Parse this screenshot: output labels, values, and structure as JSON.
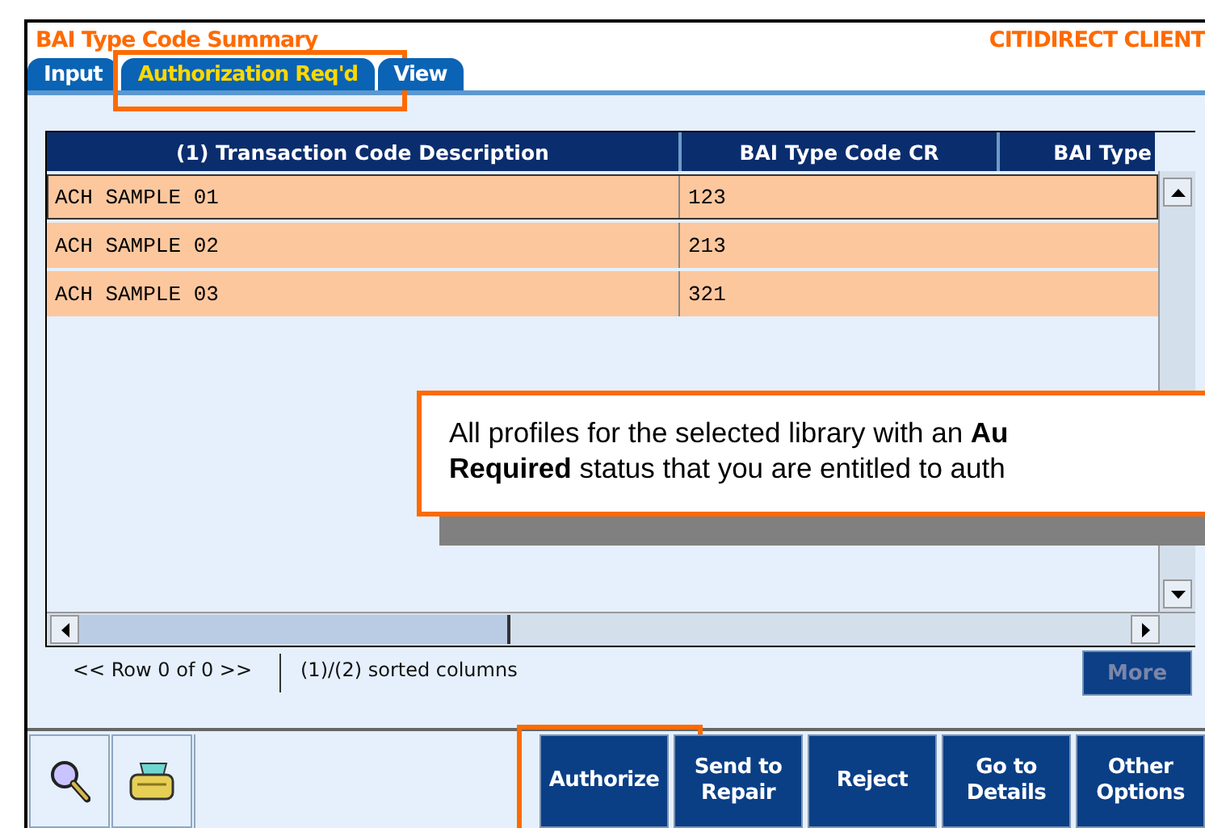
{
  "header": {
    "title": "BAI Type Code Summary",
    "client": "CITIDIRECT CLIENT"
  },
  "tabs": [
    {
      "label": "Input",
      "selected": false,
      "highlighted": false
    },
    {
      "label": "Authorization Req'd",
      "selected": true,
      "highlighted": true
    },
    {
      "label": "View",
      "selected": false,
      "highlighted": false
    }
  ],
  "table": {
    "columns": [
      "(1) Transaction Code Description",
      "BAI Type Code CR",
      "BAI Type"
    ],
    "rows": [
      {
        "cells": [
          "ACH SAMPLE 01",
          "123"
        ],
        "selected": true
      },
      {
        "cells": [
          "ACH SAMPLE 02",
          "213"
        ],
        "selected": false
      },
      {
        "cells": [
          "ACH SAMPLE 03",
          "321"
        ],
        "selected": false
      }
    ]
  },
  "callout": "All profiles for the selected library with an **Au**\n**Required** status that you are entitled to auth",
  "status": {
    "row_nav": "<< Row 0 of 0 >>",
    "sort": "(1)/(2) sorted columns",
    "more": {
      "label": "More",
      "disabled": true
    }
  },
  "tools": [
    {
      "kind": "search"
    },
    {
      "kind": "print"
    }
  ],
  "buttons": [
    {
      "label": "Authorize",
      "highlighted": true
    },
    {
      "label": "Send to Repair",
      "highlighted": false
    },
    {
      "label": "Reject",
      "highlighted": false
    },
    {
      "label": "Go to Details",
      "highlighted": false
    },
    {
      "label": "Other Options",
      "highlighted": false
    }
  ]
}
